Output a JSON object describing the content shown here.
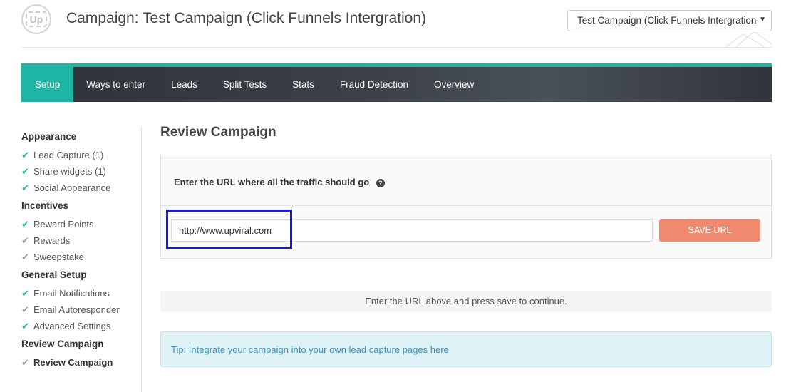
{
  "header": {
    "logo_text": "Up",
    "title": "Campaign: Test Campaign (Click Funnels Intergration)",
    "campaign_select": {
      "selected": "Test Campaign (Click Funnels Intergration"
    }
  },
  "nav": {
    "tabs": [
      {
        "label": "Setup",
        "active": true
      },
      {
        "label": "Ways to enter"
      },
      {
        "label": "Leads"
      },
      {
        "label": "Split Tests"
      },
      {
        "label": "Stats"
      },
      {
        "label": "Fraud Detection"
      },
      {
        "label": "Overview"
      }
    ]
  },
  "sidebar": {
    "groups": [
      {
        "title": "Appearance",
        "items": [
          {
            "label": "Lead Capture (1)",
            "done": true
          },
          {
            "label": "Share widgets (1)",
            "done": true
          },
          {
            "label": "Social Appearance",
            "done": true
          }
        ]
      },
      {
        "title": "Incentives",
        "items": [
          {
            "label": "Reward Points",
            "done": true
          },
          {
            "label": "Rewards",
            "done": false
          },
          {
            "label": "Sweepstake",
            "done": false
          }
        ]
      },
      {
        "title": "General Setup",
        "items": [
          {
            "label": "Email Notifications",
            "done": true
          },
          {
            "label": "Email Autoresponder",
            "done": false
          },
          {
            "label": "Advanced Settings",
            "done": true
          }
        ]
      },
      {
        "title": "Review Campaign",
        "items": [
          {
            "label": "Review Campaign",
            "done": false,
            "current": true
          }
        ]
      }
    ]
  },
  "main": {
    "title": "Review Campaign",
    "url_prompt": "Enter the URL where all the traffic should go",
    "url_value": "http://www.upviral.com",
    "save_label": "SAVE URL",
    "status_text": "Enter the URL above and press save to continue.",
    "tip_text": "Tip: Integrate your campaign into your own lead capture pages here"
  },
  "colors": {
    "accent": "#1fb5a5",
    "save_button": "#ef8a6e",
    "highlight_box": "#1a1ad4",
    "tip_text": "#3c8dbc"
  }
}
